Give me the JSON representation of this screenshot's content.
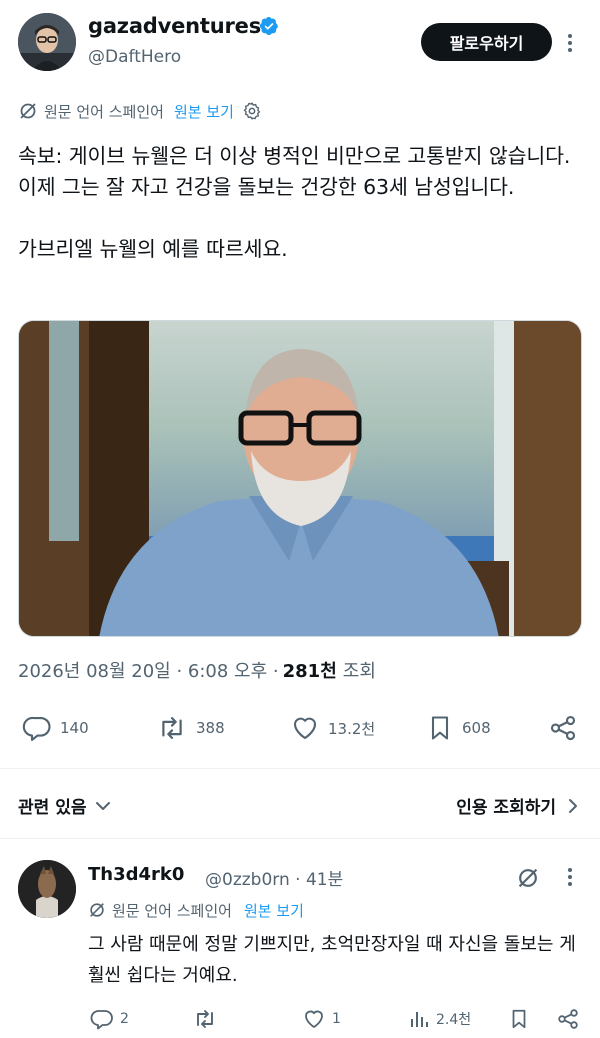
{
  "author": {
    "display_name": "gazadventures",
    "handle": "@DaftHero",
    "follow_label": "팔로우하기"
  },
  "translation": {
    "label": "원문 언어 스페인어",
    "show_original": "원본 보기"
  },
  "tweet": {
    "text": "속보: 게이브 뉴웰은 더 이상 병적인 비만으로 고통받지 않습니다. 이제 그는 잘 자고 건강을 돌보는 건강한 63세 남성입니다.\n\n가브리엘 뉴웰의 예를 따르세요.",
    "timestamp": "2026년 08월 20일 · 6:08 오후 · ",
    "views_count": "281천",
    "views_label": "조회"
  },
  "stats": {
    "replies": "140",
    "reposts": "388",
    "likes": "13.2천",
    "bookmarks": "608"
  },
  "sections": {
    "related": "관련 있음",
    "quotes": "인용 조회하기"
  },
  "reply": {
    "display_name": "Th3d4rk0",
    "handle_time": "@0zzb0rn · 41분",
    "translation_label": "원문 언어 스페인어",
    "show_original": "원본 보기",
    "text": "그 사람 때문에 정말 기쁘지만, 초억만장자일 때 자신을 돌보는 게 훨씬 쉽다는 거예요.",
    "replies": "2",
    "reposts": "",
    "likes": "1",
    "views": "2.4천"
  },
  "colors": {
    "accent": "#1d9bf0",
    "text_primary": "#0f1419",
    "text_secondary": "#536471",
    "divider": "#eff3f4"
  }
}
